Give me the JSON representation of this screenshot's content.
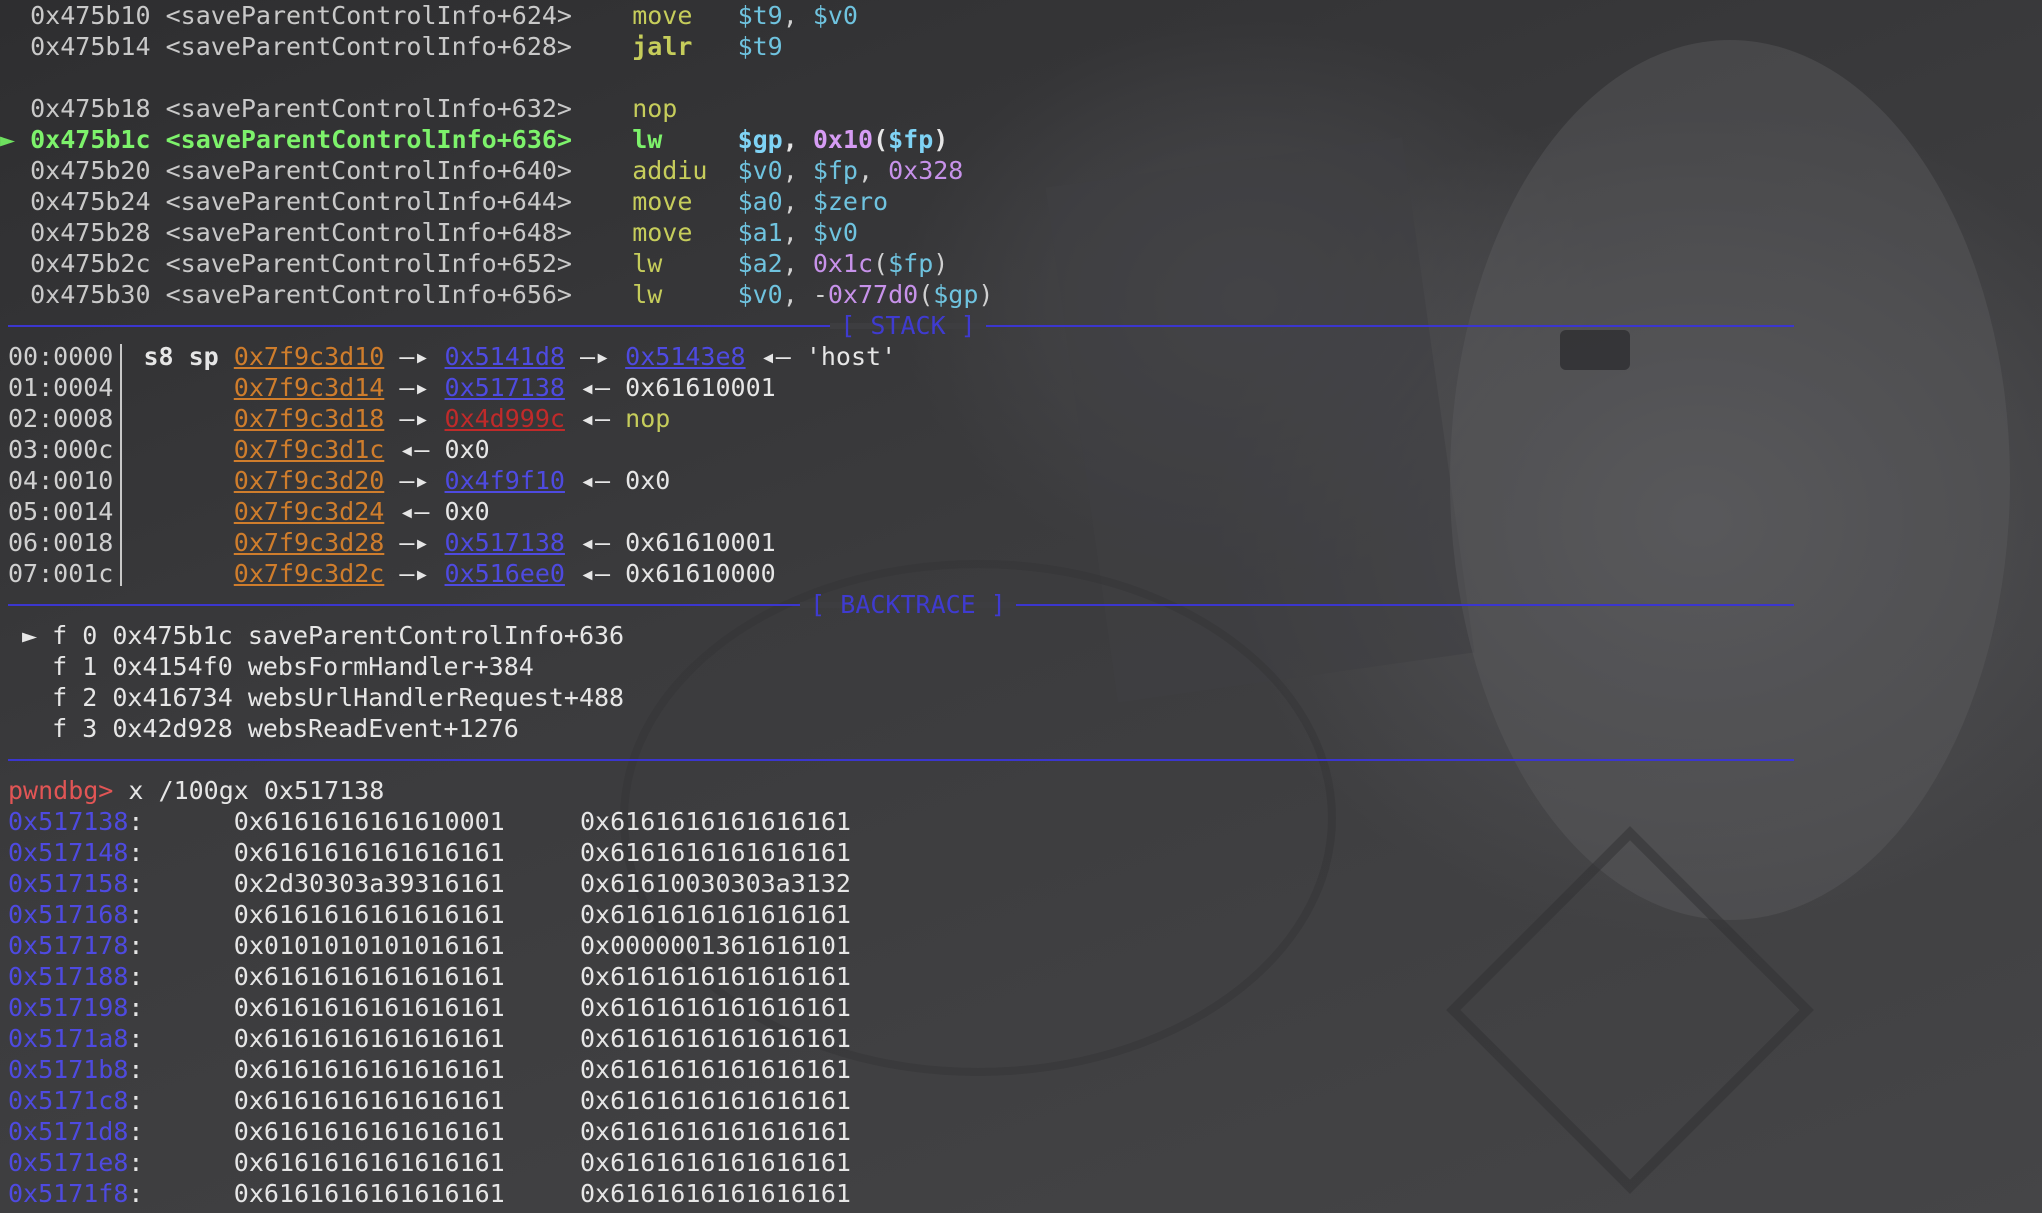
{
  "disasm": [
    {
      "addr": "0x475b10",
      "sym": "<saveParentControlInfo+624>",
      "op": "move",
      "args": [
        {
          "t": "reg",
          "v": "$t9"
        },
        {
          "t": "p",
          "v": ", "
        },
        {
          "t": "reg",
          "v": "$v0"
        }
      ],
      "current": false
    },
    {
      "addr": "0x475b14",
      "sym": "<saveParentControlInfo+628>",
      "op": "jalr",
      "args": [
        {
          "t": "reg",
          "v": "$t9"
        }
      ],
      "current": false,
      "bold_op": true
    },
    {
      "addr": "0x475b18",
      "sym": "<saveParentControlInfo+632>",
      "op": "nop",
      "args": [],
      "current": false
    },
    {
      "addr": "0x475b1c",
      "sym": "<saveParentControlInfo+636>",
      "op": "lw",
      "args": [
        {
          "t": "reg",
          "v": "$gp"
        },
        {
          "t": "p",
          "v": ", "
        },
        {
          "t": "imm",
          "v": "0x10"
        },
        {
          "t": "p",
          "v": "("
        },
        {
          "t": "reg",
          "v": "$fp"
        },
        {
          "t": "p",
          "v": ")"
        }
      ],
      "current": true
    },
    {
      "addr": "0x475b20",
      "sym": "<saveParentControlInfo+640>",
      "op": "addiu",
      "args": [
        {
          "t": "reg",
          "v": "$v0"
        },
        {
          "t": "p",
          "v": ", "
        },
        {
          "t": "reg",
          "v": "$fp"
        },
        {
          "t": "p",
          "v": ", "
        },
        {
          "t": "imm",
          "v": "0x328"
        }
      ],
      "current": false
    },
    {
      "addr": "0x475b24",
      "sym": "<saveParentControlInfo+644>",
      "op": "move",
      "args": [
        {
          "t": "reg",
          "v": "$a0"
        },
        {
          "t": "p",
          "v": ", "
        },
        {
          "t": "reg",
          "v": "$zero"
        }
      ],
      "current": false
    },
    {
      "addr": "0x475b28",
      "sym": "<saveParentControlInfo+648>",
      "op": "move",
      "args": [
        {
          "t": "reg",
          "v": "$a1"
        },
        {
          "t": "p",
          "v": ", "
        },
        {
          "t": "reg",
          "v": "$v0"
        }
      ],
      "current": false
    },
    {
      "addr": "0x475b2c",
      "sym": "<saveParentControlInfo+652>",
      "op": "lw",
      "args": [
        {
          "t": "reg",
          "v": "$a2"
        },
        {
          "t": "p",
          "v": ", "
        },
        {
          "t": "imm",
          "v": "0x1c"
        },
        {
          "t": "p",
          "v": "("
        },
        {
          "t": "reg",
          "v": "$fp"
        },
        {
          "t": "p",
          "v": ")"
        }
      ],
      "current": false
    },
    {
      "addr": "0x475b30",
      "sym": "<saveParentControlInfo+656>",
      "op": "lw",
      "args": [
        {
          "t": "reg",
          "v": "$v0"
        },
        {
          "t": "p",
          "v": ", -"
        },
        {
          "t": "imm",
          "v": "0x77d0"
        },
        {
          "t": "p",
          "v": "("
        },
        {
          "t": "reg",
          "v": "$gp"
        },
        {
          "t": "p",
          "v": ")"
        }
      ],
      "current": false
    }
  ],
  "current_marker": "►",
  "stack_title": "[ STACK ]",
  "backtrace_title": "[ BACKTRACE ]",
  "stack": [
    {
      "idx": "00:0000",
      "regs": "s8 sp",
      "chain": [
        {
          "t": "stack",
          "v": "0x7f9c3d10"
        },
        {
          "t": "a",
          "v": " —▸ "
        },
        {
          "t": "heap",
          "v": "0x5141d8"
        },
        {
          "t": "a",
          "v": " —▸ "
        },
        {
          "t": "heap",
          "v": "0x5143e8"
        },
        {
          "t": "a",
          "v": " ◂— "
        },
        {
          "t": "w",
          "v": "'host'"
        }
      ]
    },
    {
      "idx": "01:0004",
      "regs": "",
      "chain": [
        {
          "t": "stack",
          "v": "0x7f9c3d14"
        },
        {
          "t": "a",
          "v": " —▸ "
        },
        {
          "t": "heap",
          "v": "0x517138"
        },
        {
          "t": "a",
          "v": " ◂— "
        },
        {
          "t": "w",
          "v": "0x61610001"
        }
      ]
    },
    {
      "idx": "02:0008",
      "regs": "",
      "chain": [
        {
          "t": "stack",
          "v": "0x7f9c3d18"
        },
        {
          "t": "a",
          "v": " —▸ "
        },
        {
          "t": "code",
          "v": "0x4d999c"
        },
        {
          "t": "a",
          "v": " ◂— "
        },
        {
          "t": "nop",
          "v": "nop"
        }
      ]
    },
    {
      "idx": "03:000c",
      "regs": "",
      "chain": [
        {
          "t": "stack",
          "v": "0x7f9c3d1c"
        },
        {
          "t": "a",
          "v": " ◂— "
        },
        {
          "t": "w",
          "v": "0x0"
        }
      ]
    },
    {
      "idx": "04:0010",
      "regs": "",
      "chain": [
        {
          "t": "stack",
          "v": "0x7f9c3d20"
        },
        {
          "t": "a",
          "v": " —▸ "
        },
        {
          "t": "heap",
          "v": "0x4f9f10"
        },
        {
          "t": "a",
          "v": " ◂— "
        },
        {
          "t": "w",
          "v": "0x0"
        }
      ]
    },
    {
      "idx": "05:0014",
      "regs": "",
      "chain": [
        {
          "t": "stack",
          "v": "0x7f9c3d24"
        },
        {
          "t": "a",
          "v": " ◂— "
        },
        {
          "t": "w",
          "v": "0x0"
        }
      ]
    },
    {
      "idx": "06:0018",
      "regs": "",
      "chain": [
        {
          "t": "stack",
          "v": "0x7f9c3d28"
        },
        {
          "t": "a",
          "v": " —▸ "
        },
        {
          "t": "heap",
          "v": "0x517138"
        },
        {
          "t": "a",
          "v": " ◂— "
        },
        {
          "t": "w",
          "v": "0x61610001"
        }
      ]
    },
    {
      "idx": "07:001c",
      "regs": "",
      "chain": [
        {
          "t": "stack",
          "v": "0x7f9c3d2c"
        },
        {
          "t": "a",
          "v": " —▸ "
        },
        {
          "t": "heap",
          "v": "0x516ee0"
        },
        {
          "t": "a",
          "v": " ◂— "
        },
        {
          "t": "w",
          "v": "0x61610000"
        }
      ]
    }
  ],
  "backtrace": [
    {
      "marker": "►",
      "frame": "f 0",
      "addr": "0x475b1c",
      "sym": "saveParentControlInfo+636"
    },
    {
      "marker": "",
      "frame": "f 1",
      "addr": "0x4154f0",
      "sym": "websFormHandler+384"
    },
    {
      "marker": "",
      "frame": "f 2",
      "addr": "0x416734",
      "sym": "websUrlHandlerRequest+488"
    },
    {
      "marker": "",
      "frame": "f 3",
      "addr": "0x42d928",
      "sym": "websReadEvent+1276"
    }
  ],
  "prompt": "pwndbg>",
  "command": " x /100gx 0x517138",
  "memdump": [
    {
      "addr": "0x517138",
      "v1": "0x6161616161610001",
      "v2": "0x6161616161616161"
    },
    {
      "addr": "0x517148",
      "v1": "0x6161616161616161",
      "v2": "0x6161616161616161"
    },
    {
      "addr": "0x517158",
      "v1": "0x2d30303a39316161",
      "v2": "0x61610030303a3132"
    },
    {
      "addr": "0x517168",
      "v1": "0x6161616161616161",
      "v2": "0x6161616161616161"
    },
    {
      "addr": "0x517178",
      "v1": "0x0101010101016161",
      "v2": "0x0000001361616101"
    },
    {
      "addr": "0x517188",
      "v1": "0x6161616161616161",
      "v2": "0x6161616161616161"
    },
    {
      "addr": "0x517198",
      "v1": "0x6161616161616161",
      "v2": "0x6161616161616161"
    },
    {
      "addr": "0x5171a8",
      "v1": "0x6161616161616161",
      "v2": "0x6161616161616161"
    },
    {
      "addr": "0x5171b8",
      "v1": "0x6161616161616161",
      "v2": "0x6161616161616161"
    },
    {
      "addr": "0x5171c8",
      "v1": "0x6161616161616161",
      "v2": "0x6161616161616161"
    },
    {
      "addr": "0x5171d8",
      "v1": "0x6161616161616161",
      "v2": "0x6161616161616161"
    },
    {
      "addr": "0x5171e8",
      "v1": "0x6161616161616161",
      "v2": "0x6161616161616161"
    },
    {
      "addr": "0x5171f8",
      "v1": "0x6161616161616161",
      "v2": "0x6161616161616161"
    }
  ]
}
